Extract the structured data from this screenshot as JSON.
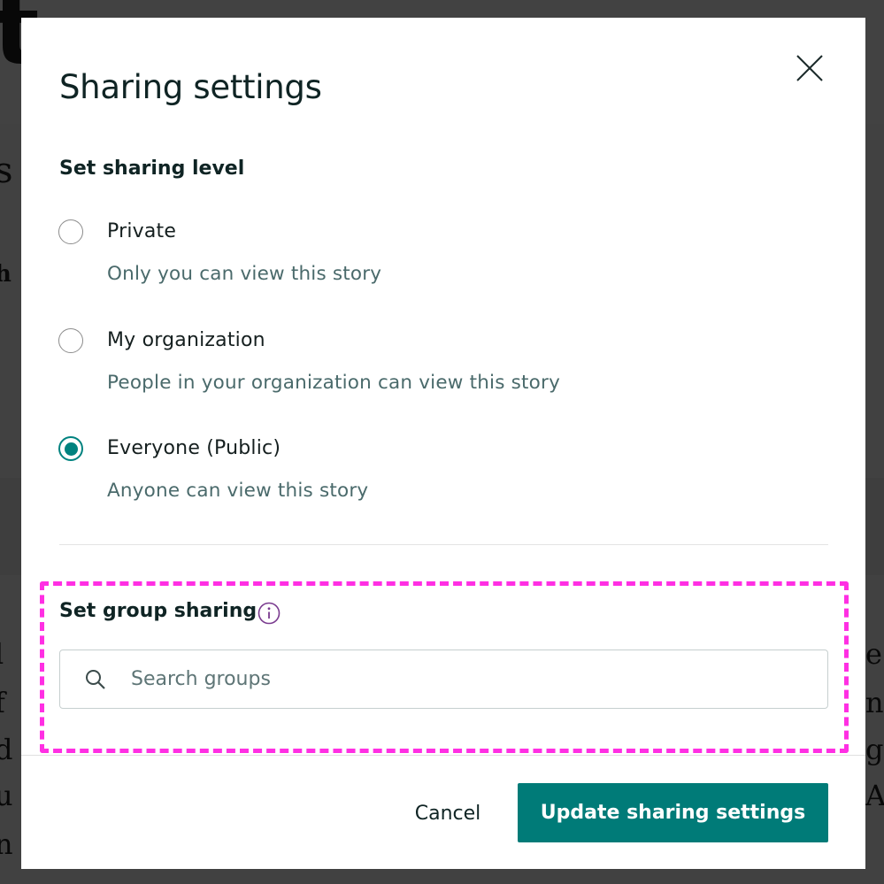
{
  "dialog": {
    "title": "Sharing settings",
    "close_icon": "close-icon"
  },
  "sharing_level": {
    "heading": "Set sharing level",
    "options": [
      {
        "label": "Private",
        "description": "Only you can view this story",
        "selected": false
      },
      {
        "label": "My organization",
        "description": "People in your organization can view this story",
        "selected": false
      },
      {
        "label": "Everyone (Public)",
        "description": "Anyone can view this story",
        "selected": true
      }
    ]
  },
  "group_sharing": {
    "heading": "Set group sharing",
    "info_icon": "info-icon",
    "search_icon": "search-icon",
    "search_placeholder": "Search groups",
    "search_value": ""
  },
  "footer": {
    "cancel_label": "Cancel",
    "submit_label": "Update sharing settings"
  },
  "colors": {
    "accent": "#007b78",
    "radio_selected": "#00827f",
    "info_icon": "#7a3b8f",
    "annotation": "#ff2fe3"
  }
}
